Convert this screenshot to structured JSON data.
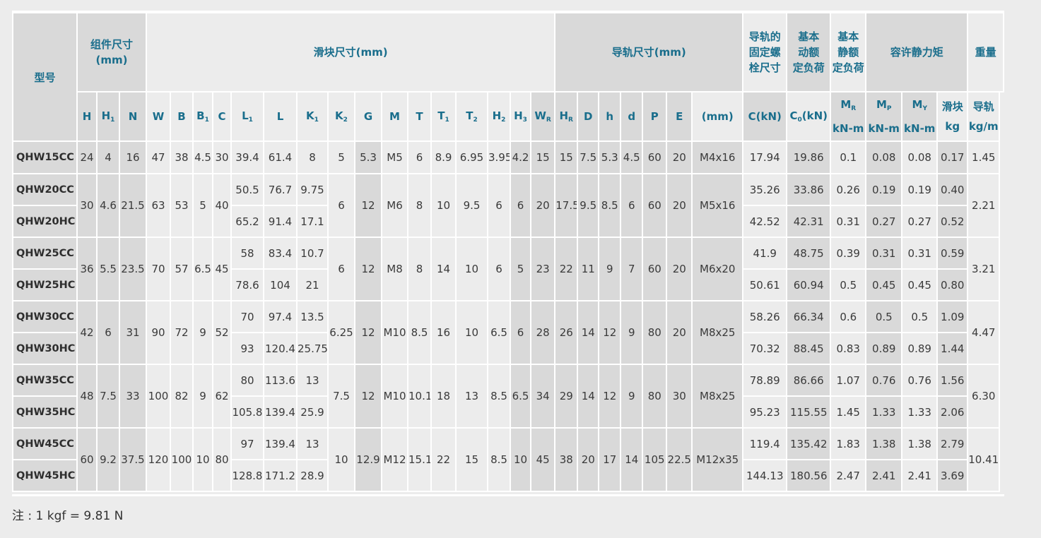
{
  "headers": {
    "model": "型号",
    "assembly": "组件尺寸\n(mm)",
    "block": "滑块尺寸(mm)",
    "rail": "导轨尺寸(mm)",
    "bolt": "导轨的\n固定螺\n栓尺寸",
    "dyn": "基本\n动额\n定负荷",
    "stat": "基本\n静额\n定负荷",
    "moment": "容许静力矩",
    "weight": "重量",
    "w_block": "滑块",
    "w_rail": "导轨",
    "mr": "M",
    "mr_sub": "R",
    "mp": "M",
    "mp_sub": "P",
    "my": "M",
    "my_sub": "Y",
    "knm": "kN-m",
    "kg": "kg",
    "kgm": "kg/m",
    "mm": "(mm)",
    "c": "C(kN)",
    "c0": "C",
    "c0_sub": "0",
    "c0_unit": "(kN)",
    "H": "H",
    "H1": "H",
    "H1_sub": "1",
    "N": "N",
    "W": "W",
    "B": "B",
    "B1": "B",
    "B1_sub": "1",
    "C": "C",
    "L1": "L",
    "L1_sub": "1",
    "L": "L",
    "K1": "K",
    "K1_sub": "1",
    "K2": "K",
    "K2_sub": "2",
    "G": "G",
    "M": "M",
    "T": "T",
    "T1": "T",
    "T1_sub": "1",
    "T2": "T",
    "T2_sub": "2",
    "H2": "H",
    "H2_sub": "2",
    "H3": "H",
    "H3_sub": "3",
    "WR": "W",
    "WR_sub": "R",
    "HR": "H",
    "HR_sub": "R",
    "D": "D",
    "h": "h",
    "d": "d",
    "P": "P",
    "E": "E"
  },
  "groups": [
    {
      "H": "30",
      "H1": "4.6",
      "N": "21.5",
      "W": "63",
      "B": "53",
      "B1": "5",
      "C": "40",
      "K2": "6",
      "G": "12",
      "M": "M6",
      "T": "8",
      "T1": "10",
      "T2": "9.5",
      "H2": "6",
      "H3": "6",
      "WR": "20",
      "HR": "17.5",
      "D": "9.5",
      "h": "8.5",
      "d": "6",
      "P": "60",
      "E": "20",
      "bolt": "M5x16",
      "rail_w": "2.21",
      "rows": [
        {
          "model": "QHW20CC",
          "L1": "50.5",
          "L": "76.7",
          "K1": "9.75",
          "C": "35.26",
          "C0": "33.86",
          "MR": "0.26",
          "MP": "0.19",
          "MY": "0.19",
          "wb": "0.40"
        },
        {
          "model": "QHW20HC",
          "L1": "65.2",
          "L": "91.4",
          "K1": "17.1",
          "C": "42.52",
          "C0": "42.31",
          "MR": "0.31",
          "MP": "0.27",
          "MY": "0.27",
          "wb": "0.52"
        }
      ]
    }
  ],
  "row15": {
    "model": "QHW15CC",
    "H": "24",
    "H1": "4",
    "N": "16",
    "W": "47",
    "B": "38",
    "B1": "4.5",
    "C": "30",
    "L1": "39.4",
    "L": "61.4",
    "K1": "8",
    "K2": "5",
    "G": "5.3",
    "M": "M5",
    "T": "6",
    "T1": "8.9",
    "T2": "6.95",
    "H2": "3.95",
    "H3": "4.2",
    "WR": "15",
    "HR": "15",
    "D": "7.5",
    "h": "5.3",
    "d": "4.5",
    "P": "60",
    "E": "20",
    "bolt": "M4x16",
    "Ck": "17.94",
    "C0": "19.86",
    "MR": "0.1",
    "MP": "0.08",
    "MY": "0.08",
    "wb": "0.17",
    "wr": "1.45"
  },
  "g20": {
    "H": "30",
    "H1": "4.6",
    "N": "21.5",
    "W": "63",
    "B": "53",
    "B1": "5",
    "C": "40",
    "K2": "6",
    "G": "12",
    "M": "M6",
    "T": "8",
    "T1": "10",
    "T2": "9.5",
    "H2": "6",
    "H3": "6",
    "WR": "20",
    "HR": "17.5",
    "D": "9.5",
    "h": "8.5",
    "d": "6",
    "P": "60",
    "E": "20",
    "bolt": "M5x16",
    "wr": "2.21",
    "a": {
      "model": "QHW20CC",
      "L1": "50.5",
      "L": "76.7",
      "K1": "9.75",
      "Ck": "35.26",
      "C0": "33.86",
      "MR": "0.26",
      "MP": "0.19",
      "MY": "0.19",
      "wb": "0.40"
    },
    "b": {
      "model": "QHW20HC",
      "L1": "65.2",
      "L": "91.4",
      "K1": "17.1",
      "Ck": "42.52",
      "C0": "42.31",
      "MR": "0.31",
      "MP": "0.27",
      "MY": "0.27",
      "wb": "0.52"
    }
  },
  "g25": {
    "H": "36",
    "H1": "5.5",
    "N": "23.5",
    "W": "70",
    "B": "57",
    "B1": "6.5",
    "C": "45",
    "K2": "6",
    "G": "12",
    "M": "M8",
    "T": "8",
    "T1": "14",
    "T2": "10",
    "H2": "6",
    "H3": "5",
    "WR": "23",
    "HR": "22",
    "D": "11",
    "h": "9",
    "d": "7",
    "P": "60",
    "E": "20",
    "bolt": "M6x20",
    "wr": "3.21",
    "a": {
      "model": "QHW25CC",
      "L1": "58",
      "L": "83.4",
      "K1": "10.7",
      "Ck": "41.9",
      "C0": "48.75",
      "MR": "0.39",
      "MP": "0.31",
      "MY": "0.31",
      "wb": "0.59"
    },
    "b": {
      "model": "QHW25HC",
      "L1": "78.6",
      "L": "104",
      "K1": "21",
      "Ck": "50.61",
      "C0": "60.94",
      "MR": "0.5",
      "MP": "0.45",
      "MY": "0.45",
      "wb": "0.80"
    }
  },
  "g30": {
    "H": "42",
    "H1": "6",
    "N": "31",
    "W": "90",
    "B": "72",
    "B1": "9",
    "C": "52",
    "K2": "6.25",
    "G": "12",
    "M": "M10",
    "T": "8.5",
    "T1": "16",
    "T2": "10",
    "H2": "6.5",
    "H3": "6",
    "WR": "28",
    "HR": "26",
    "D": "14",
    "h": "12",
    "d": "9",
    "P": "80",
    "E": "20",
    "bolt": "M8x25",
    "wr": "4.47",
    "a": {
      "model": "QHW30CC",
      "L1": "70",
      "L": "97.4",
      "K1": "13.5",
      "Ck": "58.26",
      "C0": "66.34",
      "MR": "0.6",
      "MP": "0.5",
      "MY": "0.5",
      "wb": "1.09"
    },
    "b": {
      "model": "QHW30HC",
      "L1": "93",
      "L": "120.4",
      "K1": "25.75",
      "Ck": "70.32",
      "C0": "88.45",
      "MR": "0.83",
      "MP": "0.89",
      "MY": "0.89",
      "wb": "1.44"
    }
  },
  "g35": {
    "H": "48",
    "H1": "7.5",
    "N": "33",
    "W": "100",
    "B": "82",
    "B1": "9",
    "C": "62",
    "K2": "7.5",
    "G": "12",
    "M": "M10",
    "T": "10.1",
    "T1": "18",
    "T2": "13",
    "H2": "8.5",
    "H3": "6.5",
    "WR": "34",
    "HR": "29",
    "D": "14",
    "h": "12",
    "d": "9",
    "P": "80",
    "E": "30",
    "bolt": "M8x25",
    "wr": "6.30",
    "a": {
      "model": "QHW35CC",
      "L1": "80",
      "L": "113.6",
      "K1": "13",
      "Ck": "78.89",
      "C0": "86.66",
      "MR": "1.07",
      "MP": "0.76",
      "MY": "0.76",
      "wb": "1.56"
    },
    "b": {
      "model": "QHW35HC",
      "L1": "105.8",
      "L": "139.4",
      "K1": "25.9",
      "Ck": "95.23",
      "C0": "115.55",
      "MR": "1.45",
      "MP": "1.33",
      "MY": "1.33",
      "wb": "2.06"
    }
  },
  "g45": {
    "H": "60",
    "H1": "9.2",
    "N": "37.5",
    "W": "120",
    "B": "100",
    "B1": "10",
    "C": "80",
    "K2": "10",
    "G": "12.9",
    "M": "M12",
    "T": "15.1",
    "T1": "22",
    "T2": "15",
    "H2": "8.5",
    "H3": "10",
    "WR": "45",
    "HR": "38",
    "D": "20",
    "h": "17",
    "d": "14",
    "P": "105",
    "E": "22.5",
    "bolt": "M12x35",
    "wr": "10.41",
    "a": {
      "model": "QHW45CC",
      "L1": "97",
      "L": "139.4",
      "K1": "13",
      "Ck": "119.4",
      "C0": "135.42",
      "MR": "1.83",
      "MP": "1.38",
      "MY": "1.38",
      "wb": "2.79"
    },
    "b": {
      "model": "QHW45HC",
      "L1": "128.8",
      "L": "171.2",
      "K1": "28.9",
      "Ck": "144.13",
      "C0": "180.56",
      "MR": "2.47",
      "MP": "2.41",
      "MY": "2.41",
      "wb": "3.69"
    }
  },
  "note": "注 : 1 kgf = 9.81 N"
}
